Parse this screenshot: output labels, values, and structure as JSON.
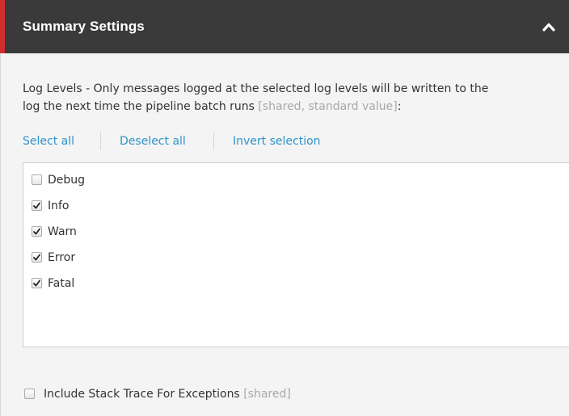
{
  "section": {
    "title": "Summary Settings",
    "collapse_icon": "chevron-up-icon",
    "accent_color": "#d12d2d"
  },
  "log_levels": {
    "description_line1": "Log Levels - Only messages logged at the selected log levels will be written to the",
    "description_line2": "log the next time the pipeline batch runs",
    "description_meta": "[shared, standard value]",
    "description_suffix": ":",
    "actions": {
      "select_all": "Select all",
      "deselect_all": "Deselect all",
      "invert_selection": "Invert selection"
    },
    "options": [
      {
        "label": "Debug",
        "checked": false
      },
      {
        "label": "Info",
        "checked": true
      },
      {
        "label": "Warn",
        "checked": true
      },
      {
        "label": "Error",
        "checked": true
      },
      {
        "label": "Fatal",
        "checked": true
      }
    ]
  },
  "stack_trace": {
    "label": "Include Stack Trace For Exceptions",
    "meta": "[shared]",
    "checked": false
  }
}
